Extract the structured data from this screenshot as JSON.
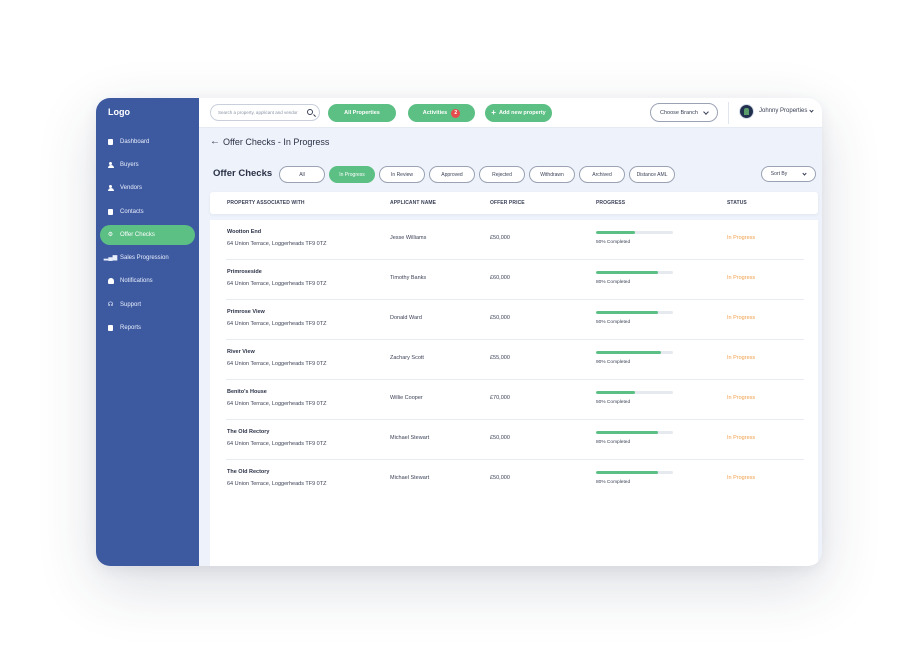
{
  "sidebar": {
    "logo": "Logo",
    "items": [
      {
        "label": "Dashboard",
        "icon": "document-icon"
      },
      {
        "label": "Buyers",
        "icon": "person-icon"
      },
      {
        "label": "Vendors",
        "icon": "person-icon"
      },
      {
        "label": "Contacts",
        "icon": "contacts-icon"
      },
      {
        "label": "Offer Checks",
        "icon": "gear-icon",
        "active": true
      },
      {
        "label": "Sales Progression",
        "icon": "bar-chart-icon"
      },
      {
        "label": "Notifications",
        "icon": "bell-icon"
      },
      {
        "label": "Support",
        "icon": "headset-icon"
      },
      {
        "label": "Reports",
        "icon": "report-icon"
      }
    ]
  },
  "topbar": {
    "search_placeholder": "Search a property, applicant and vendor",
    "all_properties": "All Properties",
    "activities": "Activities",
    "activities_count": "2",
    "add_property": "Add new property",
    "branch": "Choose Branch",
    "user": "Johnny Properties"
  },
  "page": {
    "title": "Offer Checks - In Progress",
    "section": "Offer Checks",
    "filters": [
      "All",
      "In Progress",
      "In Review",
      "Approved",
      "Rejected",
      "Withdrawn",
      "Archived",
      "Distance AML"
    ],
    "active_filter": "In Progress",
    "sort": "Sort By"
  },
  "table": {
    "headers": {
      "property": "PROPERTY ASSOCIATED WITH",
      "applicant": "APPLICANT NAME",
      "price": "OFFER PRICE",
      "progress": "PROGRESS",
      "status": "STATUS"
    },
    "rows": [
      {
        "name": "Wootton End",
        "address": "64  Union Terrace, Loggerheads TF9 0TZ",
        "applicant": "Jesse Williams",
        "price": "£50,000",
        "progress": 0.5,
        "progress_label": "50% Completed",
        "status": "In Progress"
      },
      {
        "name": "Primroseside",
        "address": "64  Union Terrace, Loggerheads TF9 0TZ",
        "applicant": "Timothy Banks",
        "price": "£60,000",
        "progress": 0.8,
        "progress_label": "80% Completed",
        "status": "In Progress"
      },
      {
        "name": "Primrose View",
        "address": "64  Union Terrace, Loggerheads TF9 0TZ",
        "applicant": "Donald Ward",
        "price": "£50,000",
        "progress": 0.8,
        "progress_label": "50% Completed",
        "status": "In Progress"
      },
      {
        "name": "River View",
        "address": "64  Union Terrace, Loggerheads TF9 0TZ",
        "applicant": "Zachary Scott",
        "price": "£55,000",
        "progress": 0.85,
        "progress_label": "90% Completed",
        "status": "In Progress"
      },
      {
        "name": "Benito's House",
        "address": "64  Union Terrace, Loggerheads TF9 0TZ",
        "applicant": "Willie Cooper",
        "price": "£70,000",
        "progress": 0.5,
        "progress_label": "50% Completed",
        "status": "In Progress"
      },
      {
        "name": "The Old Rectory",
        "address": "64  Union Terrace, Loggerheads TF9 0TZ",
        "applicant": "Michael Stewart",
        "price": "£50,000",
        "progress": 0.8,
        "progress_label": "80% Completed",
        "status": "In Progress"
      },
      {
        "name": "The Old Rectory",
        "address": "64  Union Terrace, Loggerheads TF9 0TZ",
        "applicant": "Michael Stewart",
        "price": "£50,000",
        "progress": 0.8,
        "progress_label": "80% Completed",
        "status": "In Progress"
      }
    ]
  },
  "colors": {
    "sidebar": "#3d5aa1",
    "accent": "#5cbf84",
    "status": "#f0a04b",
    "badge": "#e74c4c"
  }
}
